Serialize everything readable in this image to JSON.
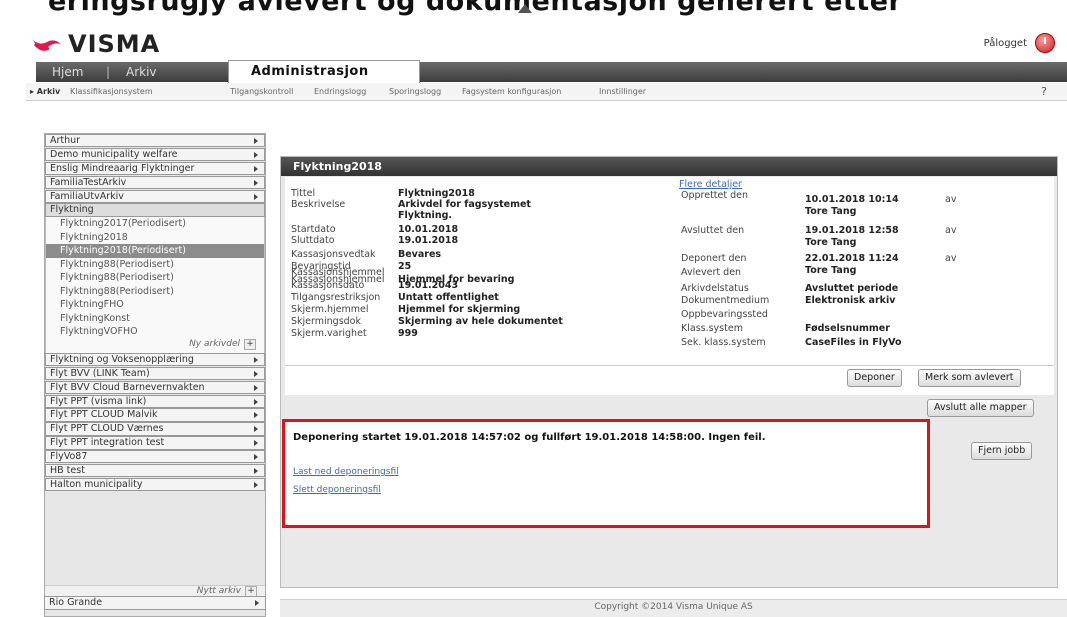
{
  "banner": {
    "text": "eringsrugjy avlevert og dokumentasjon generert etter"
  },
  "header": {
    "logo_text": "VISMA",
    "logged_in_label": "Pålogget",
    "brand_color": "#e2174b"
  },
  "nav": {
    "tabs": [
      "Hjem",
      "|",
      "Arkiv"
    ],
    "active_tab": "Administrasjon",
    "subnav": [
      "▸ Arkiv",
      "Klassifikasjonsystem",
      "Tilgangskontroll",
      "Endringslogg",
      "Sporingslogg",
      "Fagsystem konfigurasjon",
      "Innstillinger"
    ],
    "help": "?"
  },
  "sidebar": {
    "items_top": [
      "Arthur",
      "Demo municipality welfare",
      "Enslig Mindreaarig Flyktninger",
      "FamiliaTestArkiv",
      "FamiliaUtvArkiv",
      "Flyktning"
    ],
    "sub_items": [
      "Flyktning2017(Periodisert)",
      "Flyktning2018",
      "Flyktning2018(Periodisert)",
      "Flyktning88(Periodisert)",
      "Flyktning88(Periodisert)",
      "Flyktning88(Periodisert)",
      "FlyktningFHO",
      "FlyktningKonst",
      "FlyktningVOFHO"
    ],
    "selected_sub": "Flyktning2018(Periodisert)",
    "new_archive_part": "Ny arkivdel",
    "items_bottom": [
      "Flyktning og Voksenopplæring",
      "Flyt BVV (LINK Team)",
      "Flyt BVV Cloud Barnevernvakten",
      "Flyt PPT (visma link)",
      "Flyt PPT CLOUD Malvik",
      "Flyt PPT CLOUD Værnes",
      "Flyt PPT integration test",
      "FlyVo87",
      "HB test",
      "Halton municipality"
    ],
    "new_archive": "Nytt arkiv",
    "last_item": "Rio Grande"
  },
  "main": {
    "title": "Flyktning2018",
    "more_details": "Flere detaljer",
    "left_fields": [
      {
        "label": "Tittel",
        "value": "Flyktning2018"
      },
      {
        "label": "Beskrivelse",
        "value": "Arkivdel for fagsystemet"
      },
      {
        "label": "",
        "value": "Flyktning."
      },
      {
        "label": "Startdato",
        "value": "10.01.2018"
      },
      {
        "label": "Sluttdato",
        "value": "19.01.2018"
      },
      {
        "label": "Kassasjonsvedtak",
        "value": "Bevares"
      },
      {
        "label": "Bevaringstid",
        "value": "25"
      },
      {
        "label": "Kassasjonshjemmel",
        "value": "Hjemmel for bevaring"
      },
      {
        "label": "Kassasjonsdato",
        "value": "19.01.2043"
      },
      {
        "label": "Tilgangsrestriksjon",
        "value": "Untatt offentlighet"
      },
      {
        "label": "Skjerm.hjemmel",
        "value": "Hjemmel for skjerming"
      },
      {
        "label": "Skjermingsdok",
        "value": "Skjerming av hele dokumentet"
      },
      {
        "label": "Skjerm.varighet",
        "value": "999"
      }
    ],
    "right_fields": [
      {
        "label": "Opprettet den",
        "value": "10.01.2018 10:14",
        "suffix": "av",
        "by": "Tore Tang"
      },
      {
        "label": "Avsluttet den",
        "value": "19.01.2018 12:58",
        "suffix": "av",
        "by": "Tore Tang"
      },
      {
        "label": "Deponert den",
        "value": "22.01.2018 11:24",
        "suffix": "av",
        "by": "Tore Tang"
      },
      {
        "label": "Avlevert den",
        "value": ""
      },
      {
        "label": "Arkivdelstatus",
        "value": "Avsluttet periode"
      },
      {
        "label": "Dokumentmedium",
        "value": "Elektronisk arkiv"
      },
      {
        "label": "Oppbevaringssted",
        "value": ""
      },
      {
        "label": "Klass.system",
        "value": "Fødselsnummer"
      },
      {
        "label": "Sek. klass.system",
        "value": "CaseFiles in FlyVo"
      }
    ],
    "buttons": {
      "deponer": "Deponer",
      "merk_avlevert": "Merk som avlevert",
      "avslutt_mapper": "Avslutt alle mapper",
      "fjern_jobb": "Fjern jobb"
    },
    "job": {
      "status": "Deponering startet 19.01.2018 14:57:02 og fullført 19.01.2018 14:58:00. Ingen feil.",
      "download_link": "Last ned deponeringsfil",
      "delete_link": "Slett deponeringsfil"
    }
  },
  "footer": {
    "copyright": "Copyright ©2014 Visma Unique AS"
  }
}
